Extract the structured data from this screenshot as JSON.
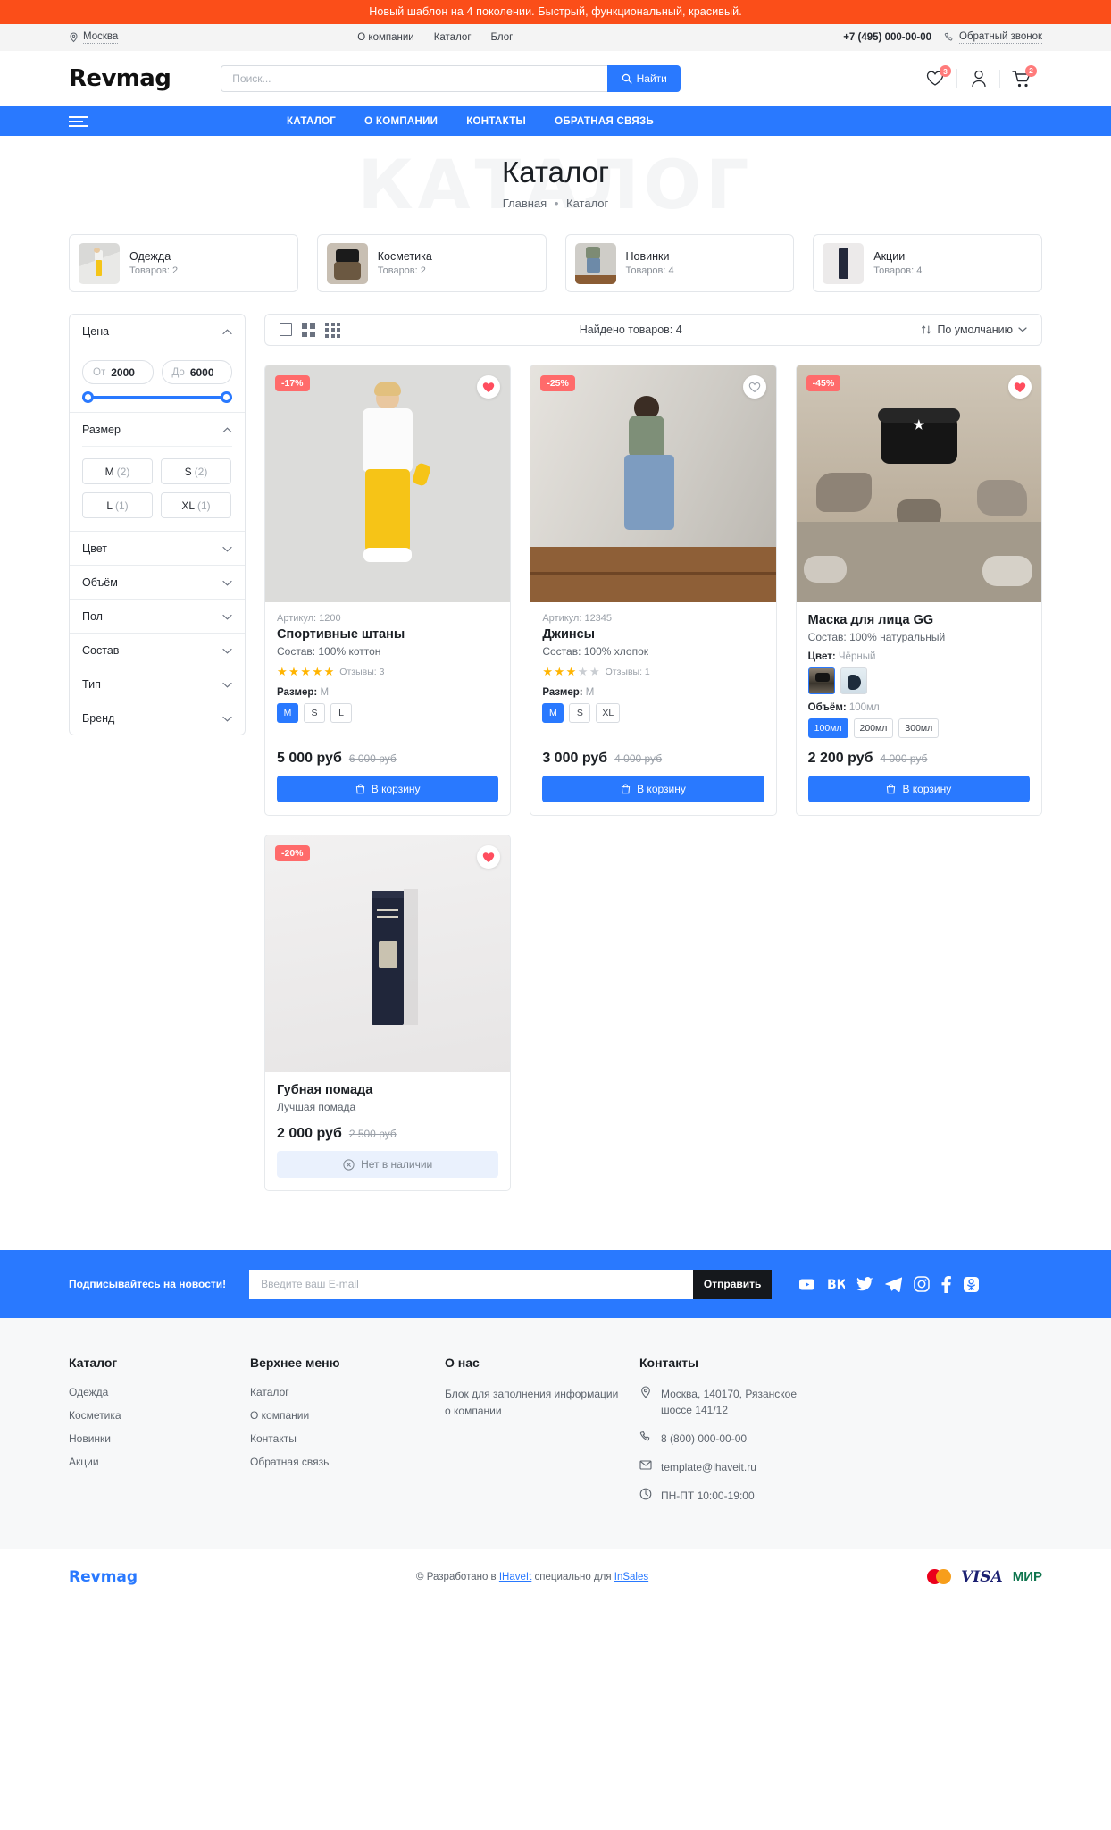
{
  "promo": {
    "text": "Новый шаблон на 4 поколении. Быстрый, функциональный, красивый."
  },
  "utilbar": {
    "city": "Москва",
    "links": [
      {
        "label": "О компании"
      },
      {
        "label": "Каталог"
      },
      {
        "label": "Блог"
      }
    ],
    "phone": "+7 (495) 000-00-00",
    "callback": "Обратный звонок"
  },
  "header": {
    "logo": "Revmag",
    "search_placeholder": "Поиск...",
    "search_value": "",
    "search_button": "Найти",
    "favorites_count": "3",
    "cart_count": "2"
  },
  "mainnav": {
    "items": [
      {
        "label": "КАТАЛОГ"
      },
      {
        "label": "О КОМПАНИИ"
      },
      {
        "label": "КОНТАКТЫ"
      },
      {
        "label": "ОБРАТНАЯ СВЯЗЬ"
      }
    ]
  },
  "pagehead": {
    "ghost": "КАТАЛОГ",
    "title": "Каталог",
    "crumb_home": "Главная",
    "crumb_sep": "•",
    "crumb_current": "Каталог"
  },
  "categories": [
    {
      "name": "Одежда",
      "count": "Товаров: 2"
    },
    {
      "name": "Косметика",
      "count": "Товаров: 2"
    },
    {
      "name": "Новинки",
      "count": "Товаров: 4"
    },
    {
      "name": "Акции",
      "count": "Товаров: 4"
    }
  ],
  "filters": {
    "price": {
      "title": "Цена",
      "from_prefix": "От",
      "from_value": "2000",
      "to_prefix": "До",
      "to_value": "6000"
    },
    "size": {
      "title": "Размер",
      "options": [
        {
          "label": "M",
          "count": "(2)"
        },
        {
          "label": "S",
          "count": "(2)"
        },
        {
          "label": "L",
          "count": "(1)"
        },
        {
          "label": "XL",
          "count": "(1)"
        }
      ]
    },
    "collapsed": [
      {
        "title": "Цвет"
      },
      {
        "title": "Объём"
      },
      {
        "title": "Пол"
      },
      {
        "title": "Состав"
      },
      {
        "title": "Тип"
      },
      {
        "title": "Бренд"
      }
    ]
  },
  "toolbar": {
    "found": "Найдено товаров: 4",
    "sort": "По умолчанию"
  },
  "products": [
    {
      "discount": "-17%",
      "sku": "Артикул: 1200",
      "name": "Спортивные штаны",
      "meta": "Состав: 100% коттон",
      "stars_on": 5,
      "stars_off": 0,
      "reviews": "Отзывы: 3",
      "option_label": "Размер:",
      "option_value": "M",
      "options": [
        "M",
        "S",
        "L"
      ],
      "selected_option": "M",
      "price_now": "5 000 руб",
      "price_old": "6 000 руб",
      "buy_label": "В корзину",
      "in_stock": true,
      "favorited": true
    },
    {
      "discount": "-25%",
      "sku": "Артикул: 12345",
      "name": "Джинсы",
      "meta": "Состав: 100% хлопок",
      "stars_on": 3,
      "stars_off": 2,
      "reviews": "Отзывы: 1",
      "option_label": "Размер:",
      "option_value": "M",
      "options": [
        "M",
        "S",
        "XL"
      ],
      "selected_option": "M",
      "price_now": "3 000 руб",
      "price_old": "4 000 руб",
      "buy_label": "В корзину",
      "in_stock": true,
      "favorited": false
    },
    {
      "discount": "-45%",
      "sku": "",
      "name": "Маска для лица GG",
      "meta": "Состав: 100% натуральный",
      "color_label": "Цвет:",
      "color_value": "Чёрный",
      "option_label": "Объём:",
      "option_value": "100мл",
      "options": [
        "100мл",
        "200мл",
        "300мл"
      ],
      "selected_option": "100мл",
      "price_now": "2 200 руб",
      "price_old": "4 000 руб",
      "buy_label": "В корзину",
      "in_stock": true,
      "favorited": true
    },
    {
      "discount": "-20%",
      "sku": "",
      "name": "Губная помада",
      "meta": "Лучшая помада",
      "price_now": "2 000 руб",
      "price_old": "2 500 руб",
      "buy_label": "Нет в наличии",
      "in_stock": false,
      "favorited": true
    }
  ],
  "subscribe": {
    "label": "Подписывайтесь на новости!",
    "placeholder": "Введите ваш E-mail",
    "value": "",
    "button": "Отправить",
    "socials": [
      "youtube-icon",
      "vk-icon",
      "twitter-icon",
      "telegram-icon",
      "instagram-icon",
      "facebook-icon",
      "odnoklassniki-icon"
    ]
  },
  "footer": {
    "col_catalog": {
      "title": "Каталог",
      "links": [
        {
          "label": "Одежда"
        },
        {
          "label": "Косметика"
        },
        {
          "label": "Новинки"
        },
        {
          "label": "Акции"
        }
      ]
    },
    "col_menu": {
      "title": "Верхнее меню",
      "links": [
        {
          "label": "Каталог"
        },
        {
          "label": "О компании"
        },
        {
          "label": "Контакты"
        },
        {
          "label": "Обратная связь"
        }
      ]
    },
    "col_about": {
      "title": "О нас",
      "text": "Блок для заполнения информации о компании"
    },
    "col_contacts": {
      "title": "Контакты",
      "address": "Москва, 140170, Рязанское шоссе 141/12",
      "phone": "8 (800) 000-00-00",
      "email": "template@ihaveit.ru",
      "hours": "ПН-ПТ 10:00-19:00"
    }
  },
  "bottom": {
    "logo": "Revmag",
    "copy_prefix": "© Разработано в ",
    "copy_company": "IHaveIt",
    "copy_mid": " специально для ",
    "copy_platform": "InSales",
    "visa": "VISA",
    "mir": "МИР"
  },
  "colors": {
    "accent": "#2979FF",
    "promo": "#FB4E19",
    "discount": "#FF6B6B",
    "star": "#FFB400"
  }
}
